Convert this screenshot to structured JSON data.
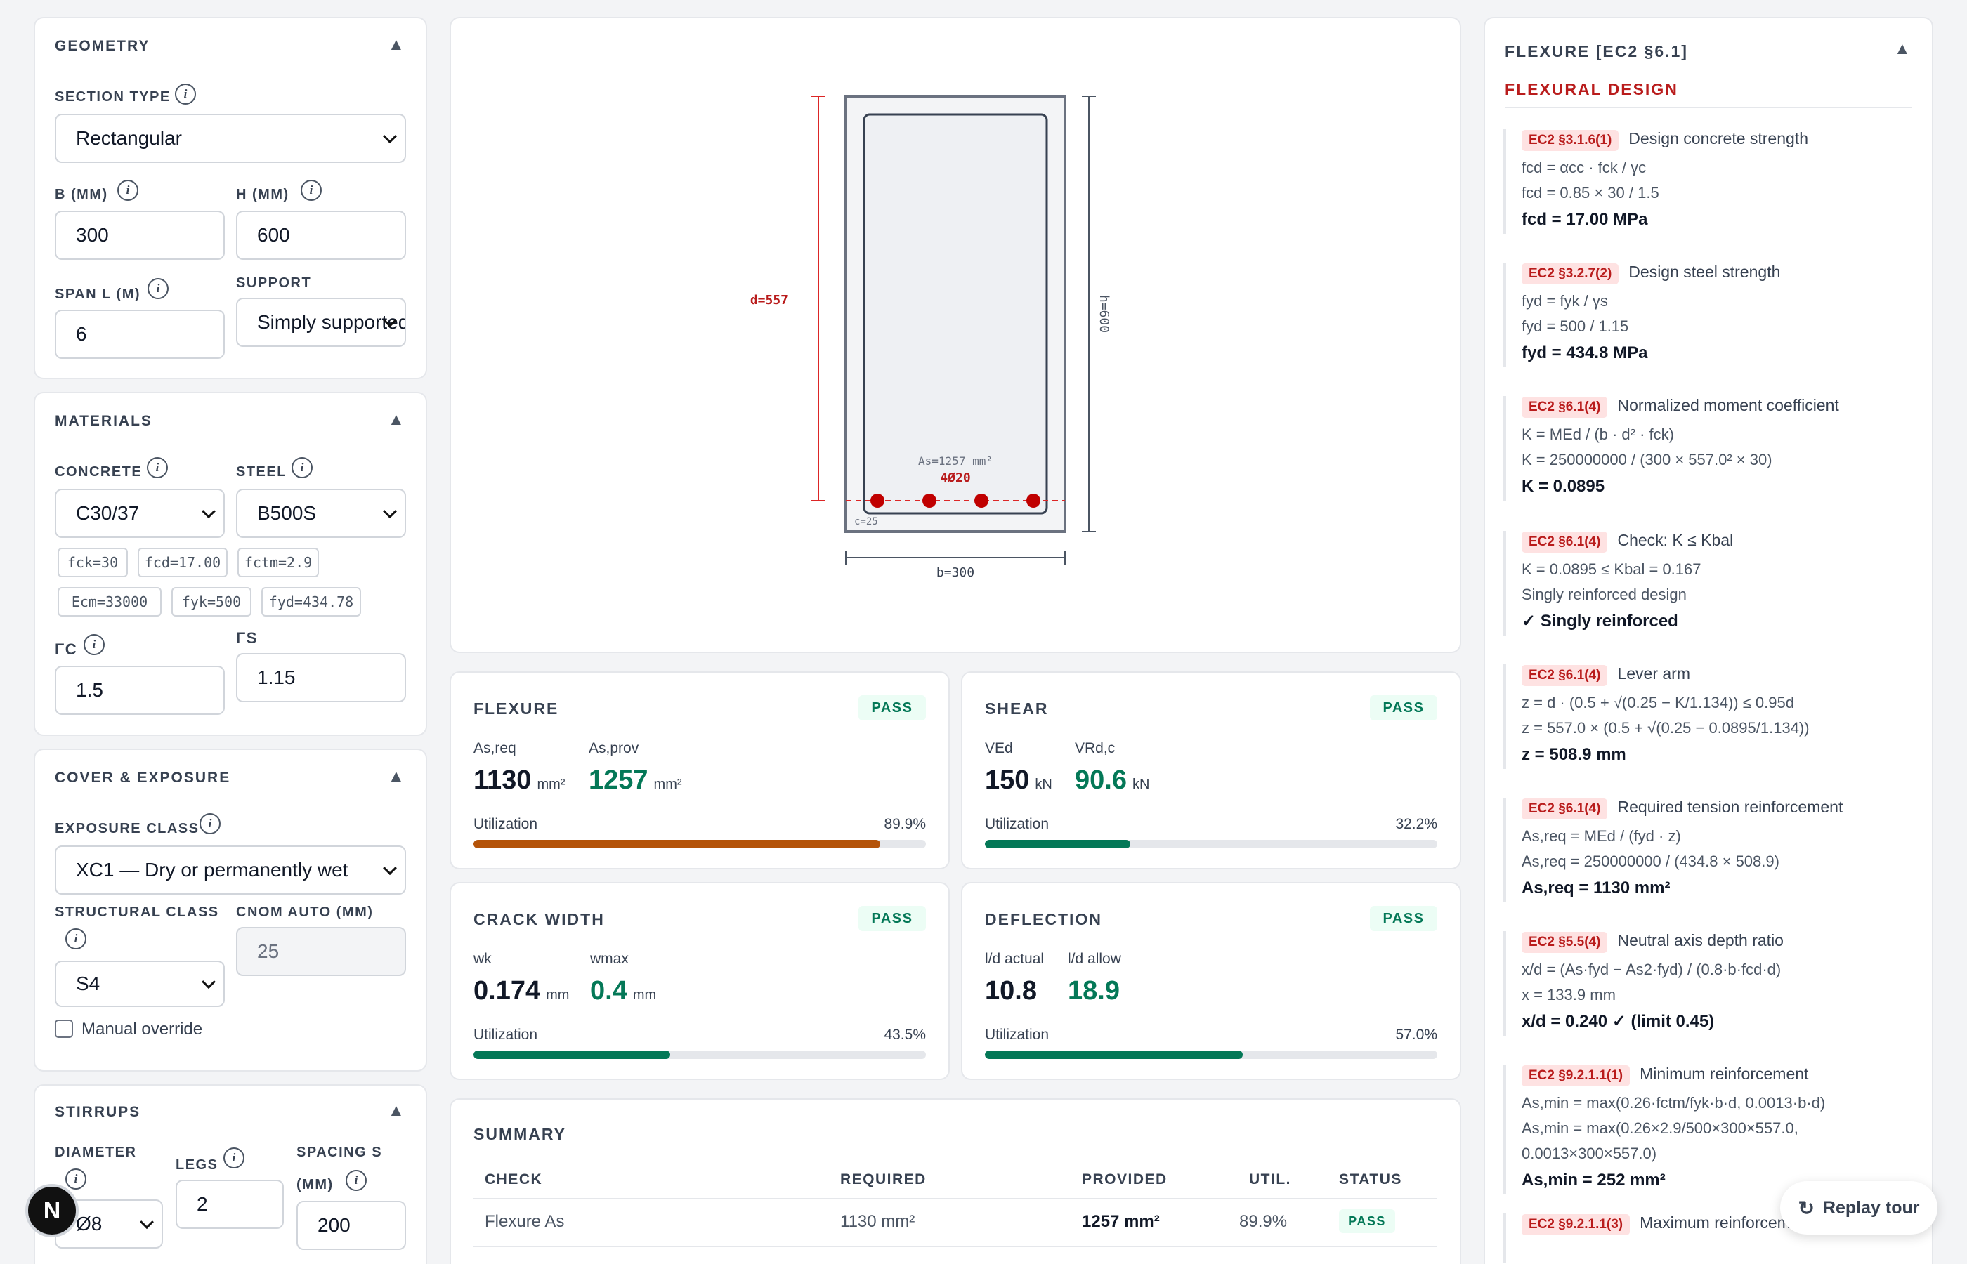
{
  "geometry": {
    "title": "GEOMETRY",
    "section_type_label": "SECTION TYPE",
    "section_type_value": "Rectangular",
    "b_label": "B (MM)",
    "b_value": "300",
    "h_label": "H (MM)",
    "h_value": "600",
    "span_label": "SPAN L (M)",
    "span_value": "6",
    "support_label": "SUPPORT",
    "support_value": "Simply supported"
  },
  "materials": {
    "title": "MATERIALS",
    "concrete_label": "CONCRETE",
    "concrete_value": "C30/37",
    "steel_label": "STEEL",
    "steel_value": "B500S",
    "chips": [
      "fck=30",
      "fcd=17.00",
      "fctm=2.9",
      "Ecm=33000",
      "fyk=500",
      "fyd=434.78"
    ],
    "gc_label": "ΓC",
    "gc_value": "1.5",
    "gs_label": "ΓS",
    "gs_value": "1.15"
  },
  "cover": {
    "title": "COVER & EXPOSURE",
    "exposure_label": "EXPOSURE CLASS",
    "exposure_value": "XC1 — Dry or permanently wet",
    "structural_label": "STRUCTURAL CLASS",
    "structural_value": "S4",
    "cnom_label": "CNOM AUTO (MM)",
    "cnom_value": "25",
    "manual_override": "Manual override"
  },
  "stirrups": {
    "title": "STIRRUPS",
    "diameter_label": "DIAMETER",
    "diameter_value": "Ø8",
    "legs_label": "LEGS",
    "legs_value": "2",
    "spacing_label": "SPACING S",
    "spacing_label2": "(MM)",
    "spacing_value": "200"
  },
  "diagram": {
    "d_label": "d=557",
    "h_label": "h=600",
    "b_label": "b=300",
    "as_label": "As=1257 mm²",
    "bars_label": "4Ø20",
    "cover_label": "c=25"
  },
  "checks": [
    {
      "title": "FLEXURE",
      "status": "PASS",
      "l1": "As,req",
      "v1": "1130",
      "u1": "mm²",
      "l2": "As,prov",
      "v2": "1257",
      "u2": "mm²",
      "util_label": "Utilization",
      "util_text": "89.9%",
      "util": 0.899,
      "color": "#b45309"
    },
    {
      "title": "SHEAR",
      "status": "PASS",
      "l1": "VEd",
      "v1": "150",
      "u1": "kN",
      "l2": "VRd,c",
      "v2": "90.6",
      "u2": "kN",
      "util_label": "Utilization",
      "util_text": "32.2%",
      "util": 0.322,
      "color": "#047857"
    },
    {
      "title": "CRACK WIDTH",
      "status": "PASS",
      "l1": "wk",
      "v1": "0.174",
      "u1": "mm",
      "l2": "wmax",
      "v2": "0.4",
      "u2": "mm",
      "util_label": "Utilization",
      "util_text": "43.5%",
      "util": 0.435,
      "color": "#047857"
    },
    {
      "title": "DEFLECTION",
      "status": "PASS",
      "l1": "l/d actual",
      "v1": "10.8",
      "u1": "",
      "l2": "l/d allow",
      "v2": "18.9",
      "u2": "",
      "util_label": "Utilization",
      "util_text": "57.0%",
      "util": 0.57,
      "color": "#047857"
    }
  ],
  "summary": {
    "title": "SUMMARY",
    "headers": [
      "CHECK",
      "REQUIRED",
      "PROVIDED",
      "UTIL.",
      "STATUS"
    ],
    "rows": [
      [
        "Flexure As",
        "1130 mm²",
        "1257 mm²",
        "89.9%",
        "PASS"
      ]
    ]
  },
  "flexure_panel": {
    "title": "FLEXURE [EC2 §6.1]",
    "subtitle": "FLEXURAL DESIGN",
    "steps": [
      {
        "tag": "EC2 §3.1.6(1)",
        "title": "Design concrete strength",
        "lines": [
          "fcd = αcc · fck / γc",
          "fcd = 0.85 × 30 / 1.5"
        ],
        "result": "fcd = 17.00 MPa"
      },
      {
        "tag": "EC2 §3.2.7(2)",
        "title": "Design steel strength",
        "lines": [
          "fyd = fyk / γs",
          "fyd = 500 / 1.15"
        ],
        "result": "fyd = 434.8 MPa"
      },
      {
        "tag": "EC2 §6.1(4)",
        "title": "Normalized moment coefficient",
        "lines": [
          "K = MEd / (b · d² · fck)",
          "K = 250000000 / (300 × 557.0² × 30)"
        ],
        "result": "K = 0.0895"
      },
      {
        "tag": "EC2 §6.1(4)",
        "title": "Check: K ≤ Kbal",
        "lines": [
          "K = 0.0895 ≤ Kbal = 0.167",
          "Singly reinforced design"
        ],
        "result": "✓ Singly reinforced"
      },
      {
        "tag": "EC2 §6.1(4)",
        "title": "Lever arm",
        "lines": [
          "z = d · (0.5 + √(0.25 − K/1.134)) ≤ 0.95d",
          "z = 557.0 × (0.5 + √(0.25 − 0.0895/1.134))"
        ],
        "result": "z = 508.9 mm"
      },
      {
        "tag": "EC2 §6.1(4)",
        "title": "Required tension reinforcement",
        "lines": [
          "As,req = MEd / (fyd · z)",
          "As,req = 250000000 / (434.8 × 508.9)"
        ],
        "result": "As,req = 1130 mm²"
      },
      {
        "tag": "EC2 §5.5(4)",
        "title": "Neutral axis depth ratio",
        "lines": [
          "x/d = (As·fyd − As2·fyd) / (0.8·b·fcd·d)",
          "x = 133.9 mm"
        ],
        "result": "x/d = 0.240 ✓ (limit 0.45)"
      },
      {
        "tag": "EC2 §9.2.1.1(1)",
        "title": "Minimum reinforcement",
        "lines": [
          "As,min = max(0.26·fctm/fyk·b·d, 0.0013·b·d)",
          "As,min = max(0.26×2.9/500×300×557.0,",
          "0.0013×300×557.0)"
        ],
        "result": "As,min = 252 mm²"
      },
      {
        "tag": "EC2 §9.2.1.1(3)",
        "title": "Maximum reinforcement",
        "lines": [],
        "result": ""
      }
    ]
  },
  "replay_tour": "Replay tour",
  "avatar_letter": "N"
}
